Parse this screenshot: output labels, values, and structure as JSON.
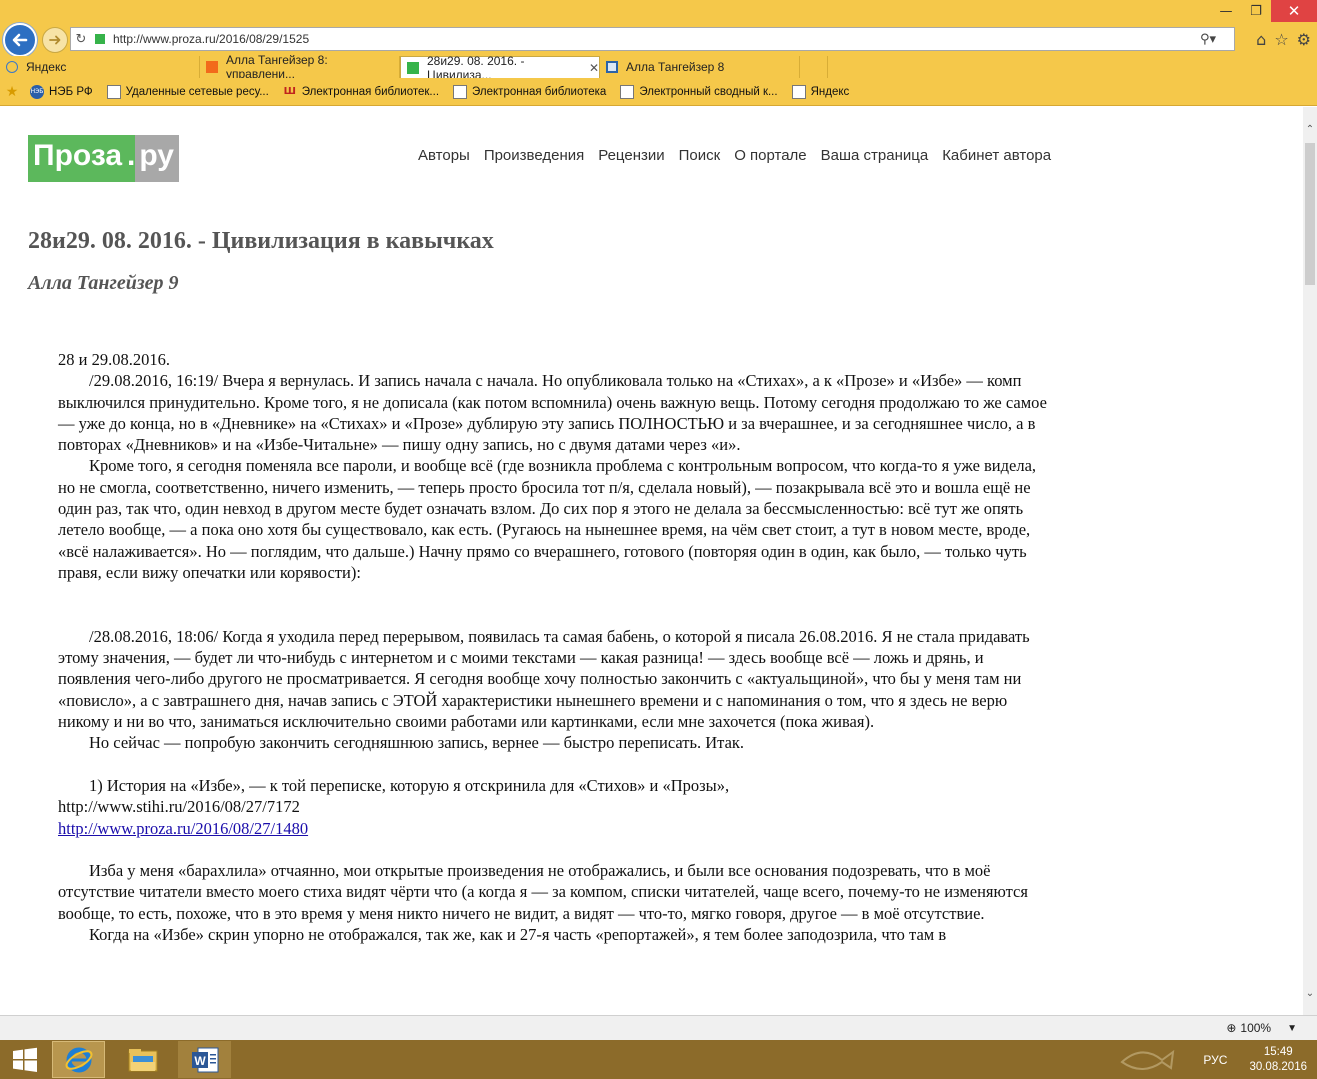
{
  "browser": {
    "address": "http://www.proza.ru/2016/08/29/1525",
    "tabs": [
      {
        "label": "Яндекс"
      },
      {
        "label": "Алла Тангейзер 8: управлени..."
      },
      {
        "label": "28и29. 08. 2016. - Цивилиза..."
      },
      {
        "label": "Алла Тангейзер 8"
      }
    ],
    "favorites": [
      {
        "label": "НЭБ РФ"
      },
      {
        "label": "Удаленные сетевые ресу..."
      },
      {
        "label": "Электронная библиотек..."
      },
      {
        "label": "Электронная библиотека"
      },
      {
        "label": "Электронный сводный к..."
      },
      {
        "label": "Яндекс"
      }
    ],
    "zoom": "100%"
  },
  "site": {
    "logo_main": "Проза",
    "logo_dot": ".",
    "logo_tail": "ру",
    "nav": [
      "Авторы",
      "Произведения",
      "Рецензии",
      "Поиск",
      "О портале",
      "Ваша страница",
      "Кабинет автора"
    ]
  },
  "work": {
    "title": "28и29. 08. 2016. - Цивилизация в кавычках",
    "author": "Алла Тангейзер 9",
    "p_date": "28 и 29.08.2016.",
    "p1": "/29.08.2016, 16:19/ Вчера я вернулась. И запись начала с начала. Но опубликовала только на «Стихах», а к «Прозе» и «Избе» — комп выключился принудительно. Кроме того, я не дописала (как потом вспомнила) очень важную вещь. Потому сегодня продолжаю то же самое — уже до конца, но в «Дневнике» на «Стихах» и «Прозе» дублирую эту запись ПОЛНОСТЬЮ и за вчерашнее, и за сегодняшнее число, а в повторах «Дневников» и на «Избе-Читальне» — пишу одну запись, но с двумя датами через «и».",
    "p2": "Кроме того, я сегодня поменяла все пароли, и вообще всё (где возникла проблема с контрольным вопросом, что когда-то я уже видела, но не смогла, соответственно, ничего изменить, — теперь просто бросила тот п/я, сделала новый), — позакрывала всё это и вошла ещё не один раз, так что, один невход в другом месте будет означать взлом. До сих пор я этого не делала за бессмысленностью: всё тут же опять летело вообще, — а пока оно хотя бы существовало, как есть. (Ругаюсь на нынешнее время, на чём свет стоит, а тут в новом месте, вроде, «всё налаживается». Но — поглядим, что дальше.) Начну прямо со вчерашнего, готового (повторяя один в один, как было, — только чуть правя, если вижу опечатки или корявости):",
    "p3": "/28.08.2016, 18:06/ Когда я уходила перед перерывом, появилась та самая бабень, о которой я писала 26.08.2016. Я не стала придавать этому значения, — будет ли что-нибудь с интернетом и с моими текстами — какая разница! — здесь вообще всё — ложь и дрянь, и появления чего-либо другого не просматривается. Я сегодня вообще хочу полностью закончить с «актуальщиной», что бы у меня там ни «повисло», а с завтрашнего дня, начав запись с ЭТОЙ характеристики нынешнего времени и с напоминания о том, что я здесь не верю никому и ни во что, заниматься исключительно своими работами или картинками, если мне захочется (пока живая).",
    "p4": "Но сейчас — попробую закончить сегодняшнюю запись, вернее — быстро переписать. Итак.",
    "p5": "1) История на «Избе», — к той переписке, которую я отскринила для «Стихов» и «Прозы»,",
    "link1": "http://www.stihi.ru/2016/08/27/7172",
    "link2": "http://www.proza.ru/2016/08/27/1480",
    "p6": "Изба у меня «барахлила» отчаянно, мои открытые произведения не отображались, и были все основания подозревать, что в моё отсутствие читатели вместо моего стиха видят чёрти что (а когда я — за компом, списки читателей, чаще всего, почему-то не изменяются вообще, то есть, похоже, что в это время у меня никто ничего не видит, а видят — что-то, мягко говоря, другое — в моё отсутствие.",
    "p7": "Когда на «Избе» скрин упорно не отображался, так же, как и 27-я часть «репортажей», я тем более заподозрила, что там в"
  },
  "taskbar": {
    "lang": "РУС",
    "time": "15:49",
    "date": "30.08.2016"
  }
}
